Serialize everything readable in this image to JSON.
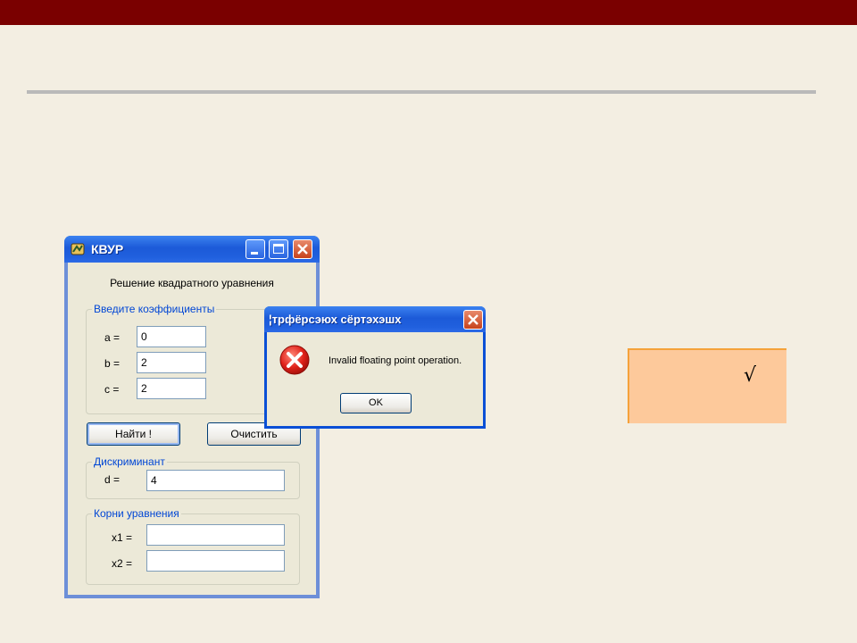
{
  "main_window": {
    "title": "КВУР",
    "heading": "Решение квадратного уравнения",
    "coefficients": {
      "group_label": "Введите коэффициенты",
      "a_label": "a =",
      "a_value": "0",
      "b_label": "b =",
      "b_value": "2",
      "c_label": "c =",
      "c_value": "2"
    },
    "find_button": "Найти !",
    "clear_button": "Очистить",
    "discriminant": {
      "group_label": "Дискриминант",
      "d_label": "d =",
      "d_value": "4"
    },
    "roots": {
      "group_label": "Корни уравнения",
      "x1_label": "x1 =",
      "x1_value": "",
      "x2_label": "x2 =",
      "x2_value": ""
    }
  },
  "error_dialog": {
    "title": "¦трфёрсэюх сёртэхэшх",
    "message": "Invalid floating point operation.",
    "ok_button": "OK",
    "icon": "error-icon"
  },
  "note_box": {
    "symbol": "√"
  },
  "colors": {
    "header_bar": "#7a0000",
    "background": "#f3eee2",
    "note_fill": "#fdc99b",
    "note_border": "#f5a23a"
  }
}
